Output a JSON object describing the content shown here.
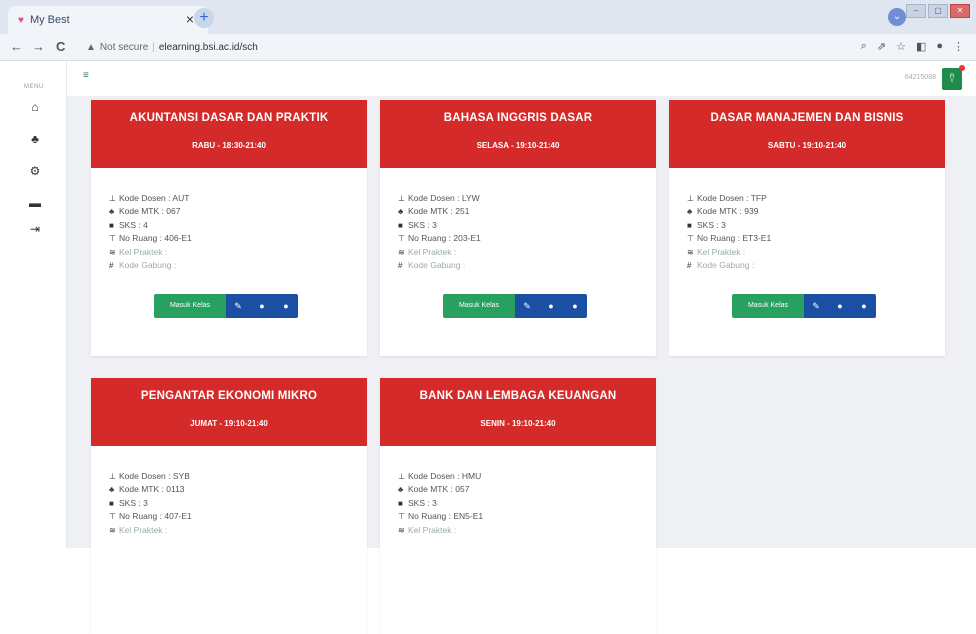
{
  "browser": {
    "tab_title": "My Best",
    "tab_close": "×",
    "new_tab": "+",
    "security": "Not secure",
    "url": "elearning.bsi.ac.id/sch"
  },
  "app": {
    "menu_label": "MENU",
    "user_id": "64215088",
    "accent_red": "#d42a2a",
    "accent_green": "#27a060",
    "accent_blue": "#1a4fa3"
  },
  "courses": [
    {
      "title": "AKUNTANSI DASAR DAN PRAKTIK",
      "schedule": "RABU - 18:30-21:40",
      "dosen": "Kode Dosen : AUT",
      "mtk": "Kode MTK : 067",
      "sks": "SKS : 4",
      "ruang": "No Ruang : 406-E1",
      "praktek": "Kel Praktek :",
      "gabung": "Kode Gabung :",
      "button": "Masuk Kelas"
    },
    {
      "title": "BAHASA INGGRIS DASAR",
      "schedule": "SELASA - 19:10-21:40",
      "dosen": "Kode Dosen : LYW",
      "mtk": "Kode MTK : 251",
      "sks": "SKS : 3",
      "ruang": "No Ruang : 203-E1",
      "praktek": "Kel Praktek :",
      "gabung": "Kode Gabung :",
      "button": "Masuk Kelas"
    },
    {
      "title": "DASAR MANAJEMEN DAN BISNIS",
      "schedule": "SABTU - 19:10-21:40",
      "dosen": "Kode Dosen : TFP",
      "mtk": "Kode MTK : 939",
      "sks": "SKS : 3",
      "ruang": "No Ruang : ET3-E1",
      "praktek": "Kel Praktek :",
      "gabung": "Kode Gabung :",
      "button": "Masuk Kelas"
    },
    {
      "title": "PENGANTAR EKONOMI MIKRO",
      "schedule": "JUMAT - 19:10-21:40",
      "dosen": "Kode Dosen : SYB",
      "mtk": "Kode MTK : 0113",
      "sks": "SKS : 3",
      "ruang": "No Ruang : 407-E1",
      "praktek": "Kel Praktek :"
    },
    {
      "title": "BANK DAN LEMBAGA KEUANGAN",
      "schedule": "SENIN - 19:10-21:40",
      "dosen": "Kode Dosen : HMU",
      "mtk": "Kode MTK : 057",
      "sks": "SKS : 3",
      "ruang": "No Ruang : EN5-E1",
      "praktek": "Kel Praktek :"
    }
  ]
}
